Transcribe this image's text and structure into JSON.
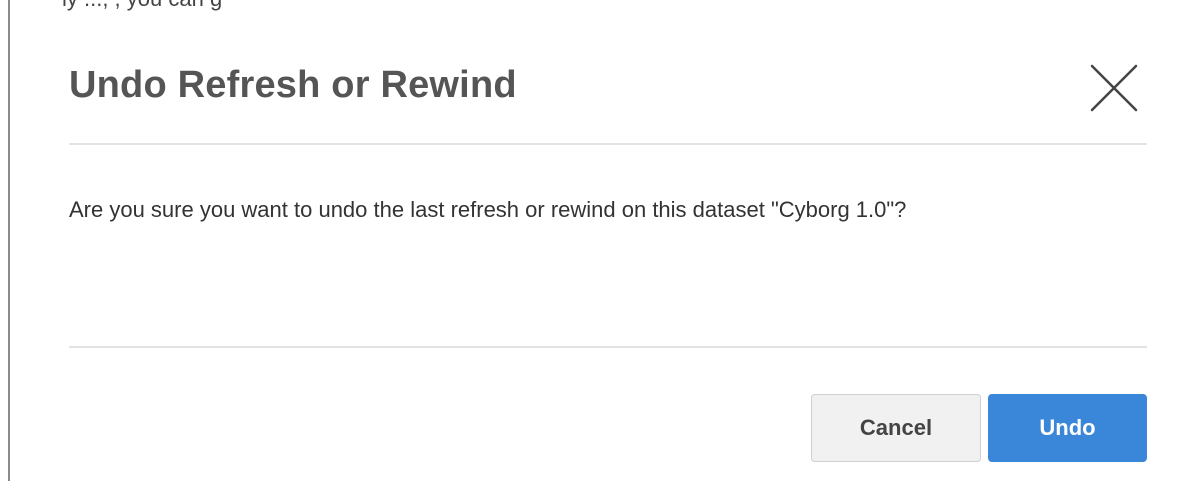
{
  "background_fragment": {
    "text": "ly                                                                     ..., , you can g"
  },
  "dialog": {
    "title": "Undo Refresh or Rewind",
    "message": "Are you sure you want to undo the last refresh or rewind on this dataset \"Cyborg 1.0\"?",
    "close_icon": "close-icon",
    "buttons": {
      "cancel_label": "Cancel",
      "undo_label": "Undo"
    }
  },
  "colors": {
    "primary": "#3a87d9",
    "title_text": "#555555",
    "body_text": "#333333",
    "divider": "#e3e3e3",
    "cancel_bg": "#f1f1f1"
  }
}
